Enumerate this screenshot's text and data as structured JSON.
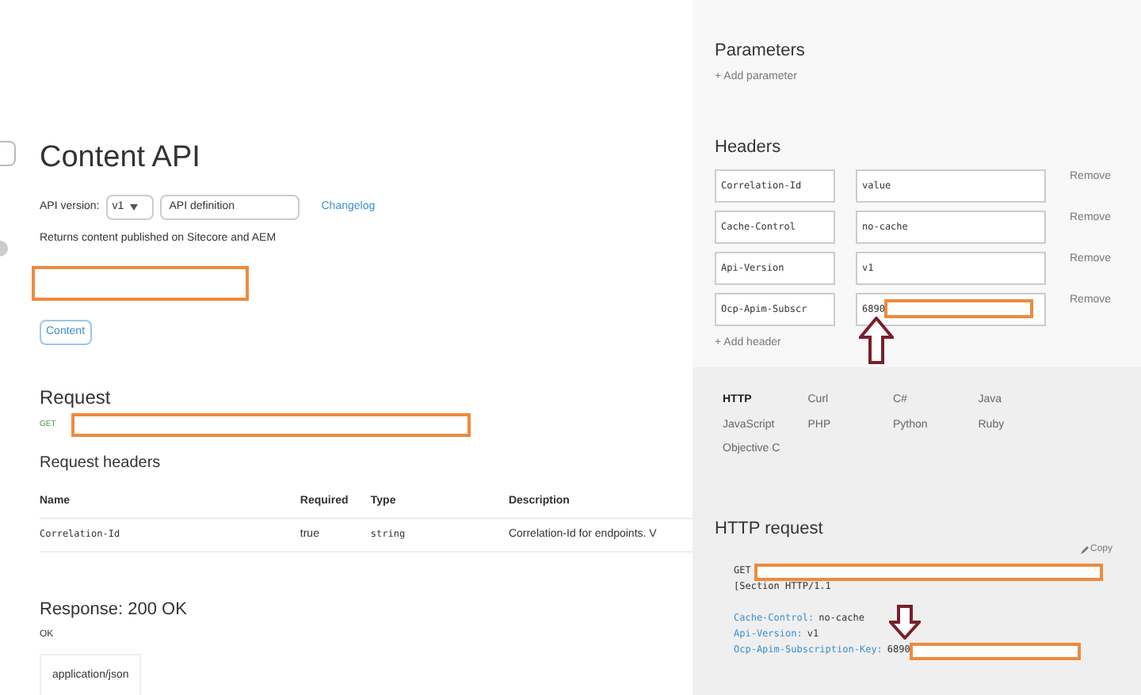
{
  "page": {
    "title": "Content API",
    "api_version_label": "API version:",
    "version_select": "v1",
    "definition_select": "API definition",
    "changelog_link": "Changelog",
    "description": "Returns content published on Sitecore and AEM",
    "tag": "Content"
  },
  "request": {
    "heading": "Request",
    "method": "GET",
    "headers_heading": "Request headers",
    "columns": [
      "Name",
      "Required",
      "Type",
      "Description"
    ],
    "rows": [
      [
        "Correlation-Id",
        "true",
        "string",
        "Correlation-Id for endpoints. V"
      ]
    ]
  },
  "response": {
    "heading": "Response: 200 OK",
    "text": "OK",
    "tabs": [
      {
        "label": "application/json",
        "selected": true
      }
    ]
  },
  "console": {
    "parameters_heading": "Parameters",
    "add_parameter": "+ Add parameter",
    "headers_heading": "Headers",
    "headers": [
      {
        "name": "Correlation-Id",
        "value": "value",
        "remove": "Remove",
        "redacted": false
      },
      {
        "name": "Cache-Control",
        "value": "no-cache",
        "remove": "Remove",
        "redacted": false
      },
      {
        "name": "Api-Version",
        "value": "v1",
        "remove": "Remove",
        "redacted": false
      },
      {
        "name": "Ocp-Apim-Subscr",
        "value": "6890",
        "remove": "Remove",
        "redacted": true
      }
    ],
    "add_header": "+ Add header",
    "languages": [
      {
        "label": "HTTP",
        "selected": true
      },
      {
        "label": "Curl",
        "selected": false
      },
      {
        "label": "C#",
        "selected": false
      },
      {
        "label": "Java",
        "selected": false
      },
      {
        "label": "JavaScript",
        "selected": false
      },
      {
        "label": "PHP",
        "selected": false
      },
      {
        "label": "Python",
        "selected": false
      },
      {
        "label": "Ruby",
        "selected": false
      },
      {
        "label": "Objective C",
        "selected": false
      }
    ],
    "http_heading": "HTTP request",
    "copy": "Copy",
    "code": [
      {
        "kind": "request",
        "text": "GET"
      },
      {
        "kind": "plain",
        "text": "[Section HTTP/1.1"
      },
      {
        "kind": "blank"
      },
      {
        "kind": "header",
        "key": "Cache-Control:",
        "value": "no-cache",
        "redacted": false
      },
      {
        "kind": "header",
        "key": "Api-Version:",
        "value": "v1",
        "redacted": false
      },
      {
        "kind": "header",
        "key": "Ocp-Apim-Subscription-Key:",
        "value": "6890",
        "redacted": true
      }
    ]
  }
}
